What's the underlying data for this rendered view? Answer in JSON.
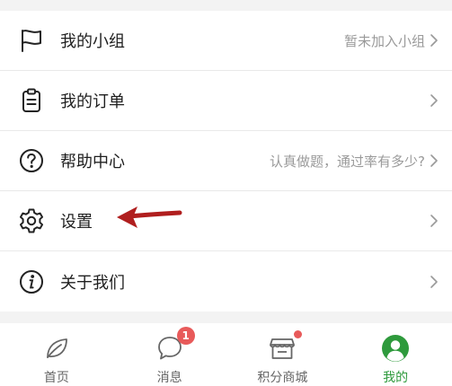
{
  "menu": {
    "items": [
      {
        "label": "我的小组",
        "right_text": "暂未加入小组",
        "icon": "flag-icon"
      },
      {
        "label": "我的订单",
        "right_text": "",
        "icon": "clipboard-icon"
      },
      {
        "label": "帮助中心",
        "right_text": "认真做题，通过率有多少?",
        "icon": "question-circle-icon"
      },
      {
        "label": "设置",
        "right_text": "",
        "icon": "gear-icon"
      },
      {
        "label": "关于我们",
        "right_text": "",
        "icon": "info-circle-icon"
      }
    ]
  },
  "tabbar": {
    "tabs": [
      {
        "label": "首页",
        "icon": "leaf-icon"
      },
      {
        "label": "消息",
        "icon": "chat-bubble-icon",
        "badge": "1"
      },
      {
        "label": "积分商城",
        "icon": "store-icon"
      },
      {
        "label": "我的",
        "icon": "user-avatar-icon"
      }
    ]
  },
  "colors": {
    "accent_green": "#2e9a3c",
    "badge_red": "#e85a5a",
    "annotation_arrow": "#b01e1e"
  }
}
